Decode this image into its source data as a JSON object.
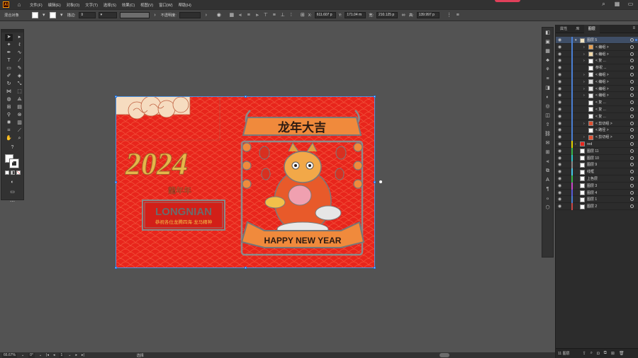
{
  "menubar": {
    "logo": "Ai",
    "items": [
      "文件(F)",
      "编辑(E)",
      "对象(O)",
      "文字(T)",
      "选择(S)",
      "效果(C)",
      "视图(V)",
      "窗口(W)",
      "帮助(H)"
    ]
  },
  "controlbar": {
    "selection_type": "混合对象",
    "stroke_label": "描边:",
    "opacity_label": "不透明度:",
    "x_label": "X:",
    "x_value": "611.607 p",
    "y_label": "Y:",
    "y_value": "171.04 m",
    "w_label": "宽:",
    "w_value": "210.125 p",
    "h_label": "高:",
    "h_value": "139.997 p"
  },
  "artwork": {
    "year_text": "2024",
    "stamp_text": "龍年年",
    "brand_title": "LONGNIAN",
    "brand_subtitle": "恭祝各位龙腾四海·龙马精神",
    "banner_title": "龙年大吉",
    "ribbon_text": "HAPPY NEW YEAR"
  },
  "panel": {
    "tabs": [
      "属性",
      "库",
      "图层"
    ],
    "active_tab": "图层",
    "layers": [
      {
        "name": "图层 5",
        "indent": 0,
        "twist": "▾",
        "color": "#4a7fd4",
        "selected": true,
        "thumb": "#f0e2c0"
      },
      {
        "name": "< 编组 >",
        "indent": 1,
        "twist": "›",
        "color": "#4a7fd4",
        "thumb": "#e8a050"
      },
      {
        "name": "< 编组 >",
        "indent": 1,
        "twist": "›",
        "color": "#4a7fd4",
        "thumb": "#f2d9a8"
      },
      {
        "name": "< 复 ...",
        "indent": 1,
        "twist": "›",
        "color": "#4a7fd4",
        "thumb": "#ffffff"
      },
      {
        "name": "恭祝 ...",
        "indent": 1,
        "twist": "",
        "color": "#4a7fd4",
        "thumb": "#ffffff"
      },
      {
        "name": "< 编组 >",
        "indent": 1,
        "twist": "›",
        "color": "#4a7fd4",
        "thumb": "#f0f0f0"
      },
      {
        "name": "< 编组 >",
        "indent": 1,
        "twist": "›",
        "color": "#4a7fd4",
        "thumb": "#dddddd"
      },
      {
        "name": "< 编组 >",
        "indent": 1,
        "twist": "›",
        "color": "#4a7fd4",
        "thumb": "#e6e6e6"
      },
      {
        "name": "< 编组 >",
        "indent": 1,
        "twist": "›",
        "color": "#4a7fd4",
        "thumb": "#eeeeee"
      },
      {
        "name": "< 复 ...",
        "indent": 1,
        "twist": "",
        "color": "#4a7fd4",
        "thumb": "#ffffff"
      },
      {
        "name": "< 复 ...",
        "indent": 1,
        "twist": "",
        "color": "#4a7fd4",
        "thumb": "#ffffff"
      },
      {
        "name": "< 复 ...",
        "indent": 1,
        "twist": "",
        "color": "#4a7fd4",
        "thumb": "#ffffff"
      },
      {
        "name": "< 剪切组 >",
        "indent": 1,
        "twist": "›",
        "color": "#4a7fd4",
        "thumb": "#e05030"
      },
      {
        "name": "< 路径 >",
        "indent": 1,
        "twist": "",
        "color": "#4a7fd4",
        "thumb": "#ffffff"
      },
      {
        "name": "< 剪切组 >",
        "indent": 1,
        "twist": "›",
        "color": "#4a7fd4",
        "thumb": "#e05030"
      },
      {
        "name": "red",
        "indent": 0,
        "twist": "›",
        "color": "#e0d000",
        "thumb": "#e8251c"
      },
      {
        "name": "图层 11",
        "indent": 0,
        "twist": "",
        "color": "#39b54a",
        "thumb": "#ffffff"
      },
      {
        "name": "图层 10",
        "indent": 0,
        "twist": "",
        "color": "#2ec4c4",
        "thumb": "#ffffff"
      },
      {
        "name": "图层 9",
        "indent": 0,
        "twist": "",
        "color": "#8a8a8a",
        "thumb": "#ffffff"
      },
      {
        "name": "线框",
        "indent": 0,
        "twist": "",
        "color": "#46c8e8",
        "thumb": "#ffffff"
      },
      {
        "name": "上色层",
        "indent": 0,
        "twist": "",
        "color": "#39b54a",
        "thumb": "#ffffff"
      },
      {
        "name": "图层 3",
        "indent": 0,
        "twist": "",
        "color": "#c846c8",
        "thumb": "#ffffff"
      },
      {
        "name": "图层 4",
        "indent": 0,
        "twist": "",
        "color": "#5a5ad8",
        "thumb": "#ffffff"
      },
      {
        "name": "图层 1",
        "indent": 0,
        "twist": "",
        "color": "#4a7fd4",
        "thumb": "#ffffff"
      },
      {
        "name": "图层 2",
        "indent": 0,
        "twist": "",
        "color": "#c84646",
        "thumb": "#ffffff"
      }
    ],
    "footer_count": "11 图层"
  },
  "statusbar": {
    "zoom": "66.67%",
    "rotation": "0°",
    "page": "1",
    "mode": "选择"
  }
}
